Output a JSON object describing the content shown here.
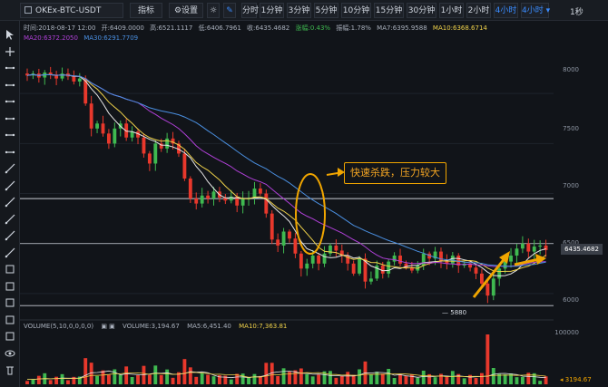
{
  "toolbar": {
    "symbol": "OKEx-BTC-USDT",
    "indicator_label": "指标",
    "settings_label": "设置",
    "intervals": [
      "分时",
      "1分钟",
      "3分钟",
      "5分钟",
      "10分钟",
      "15分钟",
      "30分钟",
      "1小时",
      "2小时",
      "4小时",
      "4小时 ▾"
    ],
    "active_interval": "4小时",
    "seconds_label": "1秒"
  },
  "ohlc": {
    "time": "时间:2018-08-17 12:00",
    "open": "开:6409.0000",
    "high": "高:6521.1117",
    "low": "低:6406.7961",
    "close": "收:6435.4682",
    "change": "涨幅:0.43%",
    "amplitude": "振幅:1.78%",
    "ma7": "MA7:6395.9588",
    "ma10": "MA10:6368.6714"
  },
  "ma_line": {
    "ma20": "MA20:6372.2050",
    "ma30": "MA30:6291.7709"
  },
  "volume_info": {
    "label": "VOLUME(5,10,0,0,0,0)",
    "volume": "VOLUME:3,194.67",
    "ma5": "MA5:6,451.40",
    "ma10": "MA10:7,363.81"
  },
  "annotation": "快速杀跌，压力较大",
  "y_axis": [
    "8000",
    "7500",
    "7000",
    "6500",
    "6000"
  ],
  "vol_axis": "100000",
  "current_price": "6435.4682",
  "current_volume": "3194.67",
  "low_marker": "5880",
  "colors": {
    "up": "#3fb950",
    "down": "#e8382c",
    "ma7": "#e8e8e8",
    "ma10": "#f0d24a",
    "ma20": "#b040d8",
    "ma30": "#4a8fe0",
    "accent": "#3a8cff",
    "annotation": "#f0a500"
  },
  "chart_data": {
    "type": "candlestick",
    "y_range": [
      5800,
      8500
    ],
    "close_series": [
      8180,
      8200,
      8160,
      8210,
      8190,
      8150,
      8200,
      8170,
      8120,
      8150,
      7900,
      7650,
      7700,
      7600,
      7500,
      7650,
      7700,
      7560,
      7620,
      7560,
      7400,
      7300,
      7500,
      7450,
      7550,
      7500,
      7400,
      7150,
      6950,
      6900,
      6980,
      6950,
      7020,
      6960,
      6930,
      6970,
      6880,
      6950,
      6950,
      7050,
      7000,
      6800,
      6540,
      6480,
      6620,
      6550,
      6400,
      6250,
      6300,
      6380,
      6300,
      6400,
      6480,
      6430,
      6380,
      6300,
      6200,
      6350,
      6120,
      6150,
      6280,
      6200,
      6320,
      6380,
      6300,
      6260,
      6230,
      6280,
      6400,
      6350,
      6420,
      6330,
      6300,
      6380,
      6280,
      6300,
      6260,
      6200,
      6100,
      5980,
      6150,
      6250,
      6320,
      6380,
      6450,
      6500,
      6420,
      6470,
      6480,
      6435
    ]
  }
}
